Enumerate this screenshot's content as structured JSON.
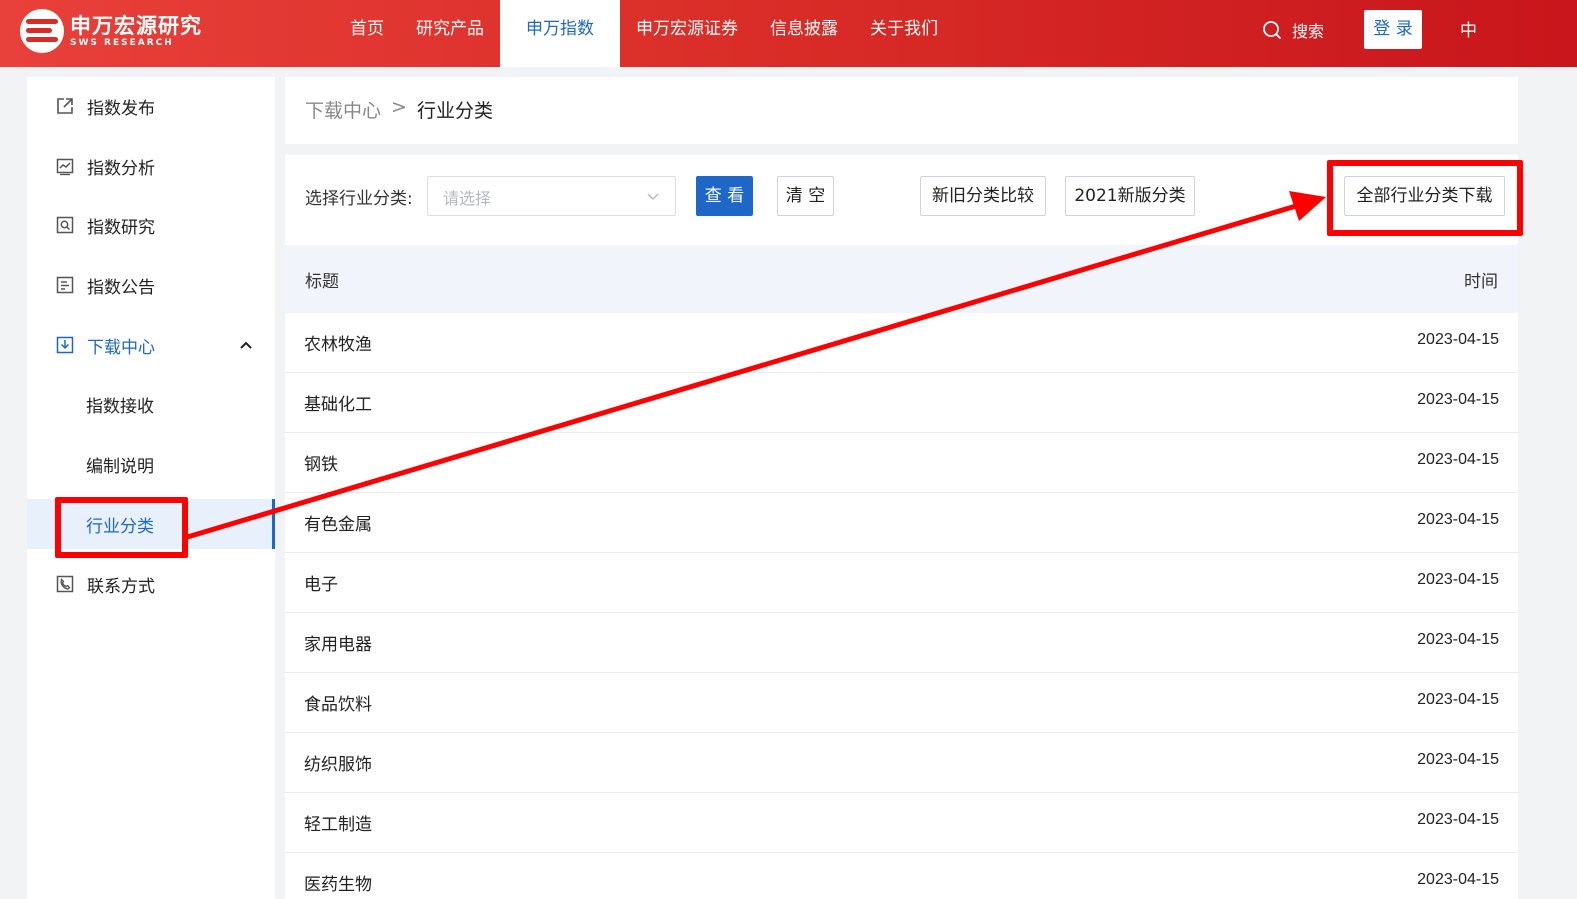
{
  "header": {
    "logo_cn": "申万宏源研究",
    "logo_en": "SWS RESEARCH",
    "nav": [
      "首页",
      "研究产品",
      "申万指数",
      "申万宏源证券",
      "信息披露",
      "关于我们"
    ],
    "search_label": "搜索",
    "login_label": "登 录",
    "lang_label": "中",
    "brand_color": "#d92c27",
    "accent_color": "#1f67c7"
  },
  "sidebar": {
    "items": [
      {
        "label": "指数发布",
        "icon": "external-link-icon"
      },
      {
        "label": "指数分析",
        "icon": "chart-window-icon"
      },
      {
        "label": "指数研究",
        "icon": "search-box-icon"
      },
      {
        "label": "指数公告",
        "icon": "document-icon"
      },
      {
        "label": "下载中心",
        "icon": "download-icon"
      },
      {
        "label": "联系方式",
        "icon": "phone-icon"
      }
    ],
    "sub_items": [
      "指数接收",
      "编制说明",
      "行业分类"
    ]
  },
  "breadcrumb": {
    "parent": "下载中心",
    "separator": ">",
    "current": "行业分类"
  },
  "filter": {
    "label": "选择行业分类:",
    "select_placeholder": "请选择",
    "view_button": "查 看",
    "clear_button": "清 空",
    "compare_button": "新旧分类比较",
    "new_version_button": "2021新版分类",
    "download_all_button": "全部行业分类下载"
  },
  "table": {
    "headers": {
      "title": "标题",
      "time": "时间"
    },
    "rows": [
      {
        "title": "农林牧渔",
        "date": "2023-04-15"
      },
      {
        "title": "基础化工",
        "date": "2023-04-15"
      },
      {
        "title": "钢铁",
        "date": "2023-04-15"
      },
      {
        "title": "有色金属",
        "date": "2023-04-15"
      },
      {
        "title": "电子",
        "date": "2023-04-15"
      },
      {
        "title": "家用电器",
        "date": "2023-04-15"
      },
      {
        "title": "食品饮料",
        "date": "2023-04-15"
      },
      {
        "title": "纺织服饰",
        "date": "2023-04-15"
      },
      {
        "title": "轻工制造",
        "date": "2023-04-15"
      },
      {
        "title": "医药生物",
        "date": "2023-04-15"
      }
    ]
  },
  "annotation_color": "#ff0000"
}
